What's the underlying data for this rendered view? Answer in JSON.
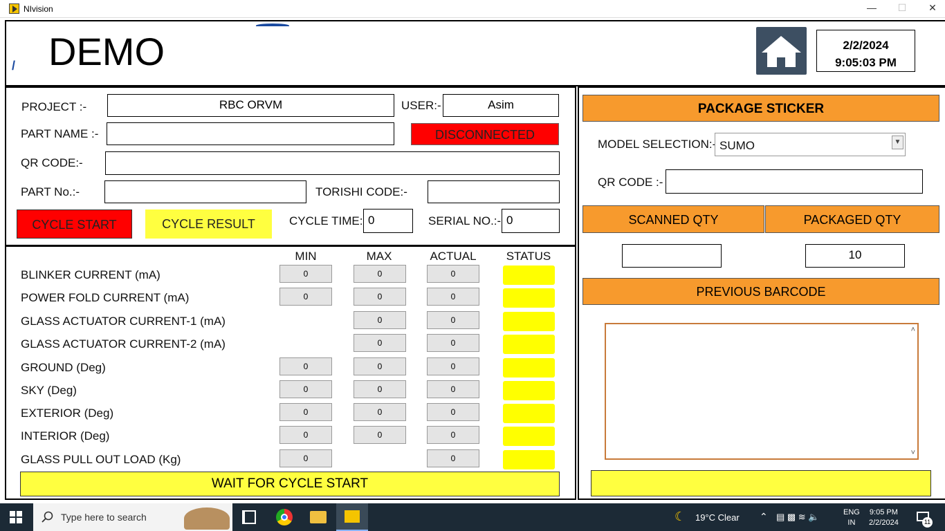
{
  "window": {
    "title": "NIvision",
    "min": "—",
    "max": "☐",
    "close": "✕"
  },
  "header": {
    "title": "DEMO",
    "date": "2/2/2024",
    "time": "9:05:03 PM"
  },
  "left": {
    "project_label": "PROJECT :-",
    "project_value": "RBC ORVM",
    "user_label": "USER:-",
    "user_value": "Asim",
    "part_name_label": "PART NAME :-",
    "part_name_value": "",
    "connection_status": "DISCONNECTED",
    "qr_label": "QR CODE:-",
    "qr_value": "",
    "part_no_label": "PART No.:-",
    "part_no_value": "",
    "torishi_label": "TORISHI CODE:-",
    "torishi_value": "",
    "cycle_start": "CYCLE START",
    "cycle_result": "CYCLE RESULT",
    "cycle_time_label": "CYCLE TIME:-",
    "cycle_time_value": "0",
    "serial_label": "SERIAL NO.:-",
    "serial_value": "0"
  },
  "table": {
    "headers": [
      "MIN",
      "MAX",
      "ACTUAL",
      "STATUS"
    ],
    "rows": [
      {
        "label": "BLINKER CURRENT (mA)",
        "min": "0",
        "max": "0",
        "actual": "0"
      },
      {
        "label": "POWER FOLD CURRENT (mA)",
        "min": "0",
        "max": "0",
        "actual": "0"
      },
      {
        "label": "GLASS ACTUATOR CURRENT-1 (mA)",
        "min": null,
        "max": "0",
        "actual": "0"
      },
      {
        "label": "GLASS ACTUATOR CURRENT-2 (mA)",
        "min": null,
        "max": "0",
        "actual": "0"
      },
      {
        "label": "GROUND (Deg)",
        "min": "0",
        "max": "0",
        "actual": "0"
      },
      {
        "label": "SKY (Deg)",
        "min": "0",
        "max": "0",
        "actual": "0"
      },
      {
        "label": "EXTERIOR (Deg)",
        "min": "0",
        "max": "0",
        "actual": "0"
      },
      {
        "label": "INTERIOR (Deg)",
        "min": "0",
        "max": "0",
        "actual": "0"
      },
      {
        "label": "GLASS PULL OUT LOAD (Kg)",
        "min": "0",
        "max": null,
        "actual": "0"
      }
    ],
    "footer_message": "WAIT FOR CYCLE START"
  },
  "right": {
    "header": "PACKAGE STICKER",
    "model_label": "MODEL SELECTION:-",
    "model_value": "SUMO",
    "qr_label": "QR CODE :-",
    "qr_value": "",
    "scanned_label": "SCANNED QTY",
    "packaged_label": "PACKAGED QTY",
    "scanned_value": "",
    "packaged_value": "10",
    "previous_barcode_label": "PREVIOUS BARCODE",
    "previous_barcode_value": "",
    "footer_message": ""
  },
  "taskbar": {
    "search_placeholder": "Type here to search",
    "weather": "19°C  Clear",
    "lang": "ENG",
    "region": "IN",
    "clock_time": "9:05 PM",
    "clock_date": "2/2/2024",
    "notif_count": "11"
  },
  "colors": {
    "red": "#ff0000",
    "yellow": "#ffff00",
    "orange": "#f79a2d",
    "home": "#3d4f62"
  }
}
